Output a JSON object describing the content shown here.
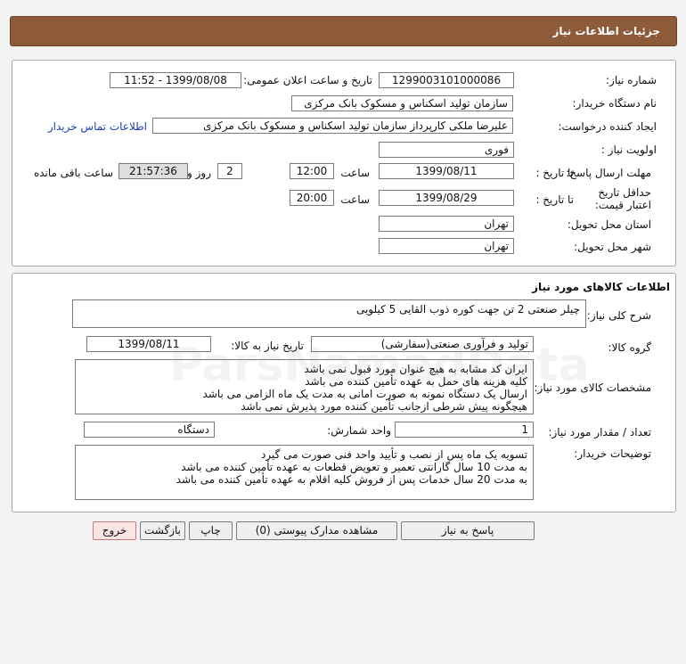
{
  "header": {
    "title": "جزئیات اطلاعات نیاز"
  },
  "info": {
    "need_number_label": "شماره نیاز:",
    "need_number": "1299003101000086",
    "announce_label": "تاریخ و ساعت اعلان عمومی:",
    "announce_value": "1399/08/08 - 11:52",
    "buyer_org_label": "نام دستگاه خریدار:",
    "buyer_org": "سازمان تولید اسکناس و مسکوک بانک مرکزی",
    "requester_label": "ایجاد کننده درخواست:",
    "requester": "علیرضا ملکی کارپرداز سازمان تولید اسکناس و مسکوک بانک مرکزی",
    "contact_link": "اطلاعات تماس خریدار",
    "priority_label": "اولویت نیاز :",
    "priority": "فوری",
    "deadline_label": "مهلت ارسال پاسخ:",
    "to_date_label": "تا تاریخ :",
    "deadline_date": "1399/08/11",
    "time_label": "ساعت",
    "deadline_time": "12:00",
    "days_value": "2",
    "days_label": "روز و",
    "remaining_time": "21:57:36",
    "remaining_label": "ساعت باقی مانده",
    "validity_label": "حداقل تاریخ اعتبار قیمت:",
    "validity_to_label": "تا تاریخ :",
    "validity_date": "1399/08/29",
    "validity_time_label": "ساعت",
    "validity_time": "20:00",
    "province_label": "استان محل تحویل:",
    "province": "تهران",
    "city_label": "شهر محل تحویل:",
    "city": "تهران"
  },
  "goods": {
    "section_title": "اطلاعات کالاهای مورد نیاز",
    "summary_label": "شرح کلی نیاز:",
    "summary": "چیلر صنعتی 2 تن جهت کوره ذوب القایی 5 کیلویی",
    "group_label": "گروه کالا:",
    "group": "تولید و فرآوری صنعتی(سفارشی)",
    "need_date_label": "تاریخ نیاز به کالا:",
    "need_date": "1399/08/11",
    "specs_label": "مشخصات کالای مورد نیاز:",
    "specs": [
      "ایران کد مشابه به هیچ عنوان مورد قبول نمی باشد",
      "کلیه هزینه های حمل به عهده تأمین کننده می باشد",
      "ارسال یک دستگاه نمونه به صورت امانی به مدت یک ماه الزامی می باشد",
      "هیچگونه پیش شرطی ازجانب تأمین کننده مورد پذیرش نمی باشد"
    ],
    "qty_label": "تعداد / مقدار مورد نیاز:",
    "qty": "1",
    "unit_label": "واحد شمارش:",
    "unit": "دستگاه",
    "buyer_notes_label": "توضیحات خریدار:",
    "buyer_notes": [
      "تسویه یک ماه پس از نصب و تأیید واحد فنی صورت می گیرد",
      "به مدت 10 سال گارانتی تعمیر و تعویض قطعات به عهده تأمین کننده می باشد",
      "به مدت 20 سال خدمات پس از فروش کلیه اقلام به عهده تأمین کننده می باشد"
    ]
  },
  "buttons": {
    "reply": "پاسخ به نیاز",
    "attachments": "مشاهده مدارک پیوستی (0)",
    "print": "چاپ",
    "back": "بازگشت",
    "exit": "خروج"
  },
  "colors": {
    "header_bg": "#8d5a3a",
    "link": "#1d3fb3",
    "exit_bg": "#fbe4e4"
  }
}
